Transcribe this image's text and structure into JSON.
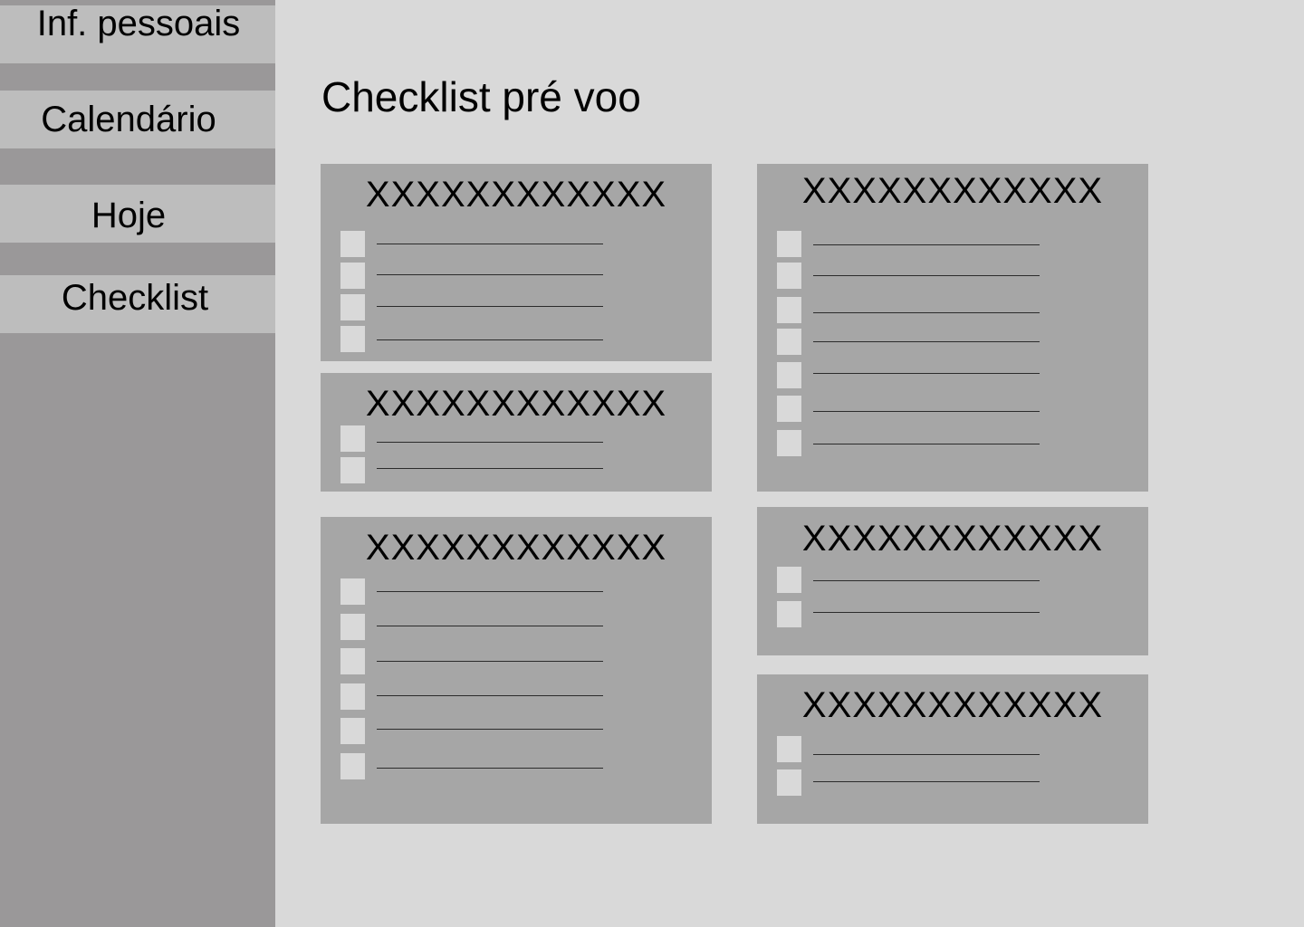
{
  "sidebar": {
    "items": [
      {
        "label": "Inf. pessoais"
      },
      {
        "label": "Calendário"
      },
      {
        "label": "Hoje"
      },
      {
        "label": "Checklist"
      }
    ]
  },
  "main": {
    "title": "Checklist pré voo",
    "cards": [
      {
        "title": "XXXXXXXXXXXX",
        "item_count": 4
      },
      {
        "title": "XXXXXXXXXXXX",
        "item_count": 2
      },
      {
        "title": "XXXXXXXXXXXX",
        "item_count": 6
      },
      {
        "title": "XXXXXXXXXXXX",
        "item_count": 7
      },
      {
        "title": "XXXXXXXXXXXX",
        "item_count": 2
      },
      {
        "title": "XXXXXXXXXXXX",
        "item_count": 2
      }
    ]
  },
  "colors": {
    "page_bg": "#d9d9d9",
    "sidebar_bg": "#9a9899",
    "nav_item_bg": "#bdbdbd",
    "card_bg": "#a6a6a6",
    "checkbox_bg": "#d9d9d9"
  }
}
